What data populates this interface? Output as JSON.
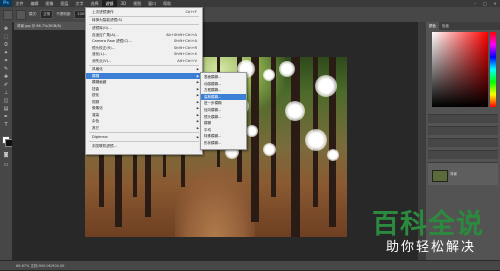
{
  "menubar": {
    "logo": "Ps",
    "items": [
      "文件",
      "编辑",
      "图像",
      "图层",
      "文字",
      "选择",
      "滤镜",
      "3D",
      "视图",
      "窗口",
      "帮助"
    ],
    "active_index": 6
  },
  "options_bar": {
    "mode_label": "模式:",
    "mode_value": "正常",
    "opacity_label": "不透明度:",
    "opacity_value": "100%"
  },
  "document_tab": "背景.jpg @ 66.7%(RGB/8)",
  "filter_menu": {
    "items": [
      {
        "label": "上次滤镜操作",
        "shortcut": "Ctrl+F"
      },
      {
        "label": "转换为智能滤镜(S)",
        "shortcut": ""
      },
      {
        "label": "滤镜库(G)...",
        "shortcut": ""
      },
      {
        "label": "自适应广角(A)...",
        "shortcut": "Alt+Shift+Ctrl+A"
      },
      {
        "label": "Camera Raw 滤镜(C)...",
        "shortcut": "Shift+Ctrl+A"
      },
      {
        "label": "镜头校正(R)...",
        "shortcut": "Shift+Ctrl+R"
      },
      {
        "label": "液化(L)...",
        "shortcut": "Shift+Ctrl+X"
      },
      {
        "label": "消失点(V)...",
        "shortcut": "Alt+Ctrl+V"
      },
      {
        "label": "风格化",
        "shortcut": ""
      },
      {
        "label": "模糊",
        "shortcut": ""
      },
      {
        "label": "模糊画廊",
        "shortcut": ""
      },
      {
        "label": "扭曲",
        "shortcut": ""
      },
      {
        "label": "锐化",
        "shortcut": ""
      },
      {
        "label": "视频",
        "shortcut": ""
      },
      {
        "label": "像素化",
        "shortcut": ""
      },
      {
        "label": "渲染",
        "shortcut": ""
      },
      {
        "label": "杂色",
        "shortcut": ""
      },
      {
        "label": "其它",
        "shortcut": ""
      },
      {
        "label": "Digimarc",
        "shortcut": ""
      },
      {
        "label": "浏览联机滤镜...",
        "shortcut": ""
      }
    ],
    "highlighted_index": 9
  },
  "blur_submenu": {
    "items": [
      "表面模糊...",
      "动感模糊...",
      "方框模糊...",
      "高斯模糊...",
      "进一步模糊",
      "径向模糊...",
      "镜头模糊...",
      "模糊",
      "平均",
      "特殊模糊...",
      "形状模糊..."
    ],
    "highlighted_index": 3
  },
  "panel": {
    "tabs": [
      "颜色",
      "色板"
    ],
    "layer_name": "背景"
  },
  "status": "66.67%   文档:900.0K/900.0K",
  "watermark": {
    "title": "百科全说",
    "subtitle": "助你轻松解决"
  },
  "colors": {
    "menu_highlight": "#3c7fd4",
    "watermark_green": "#2b8a3e"
  }
}
